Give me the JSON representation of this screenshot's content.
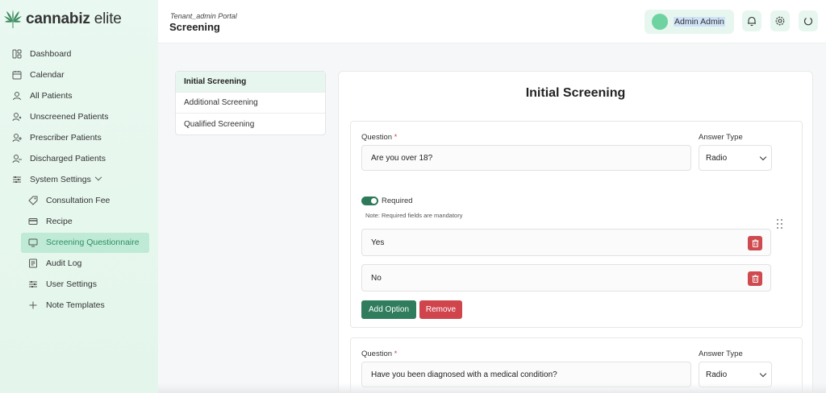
{
  "brand": {
    "name_bold": "cannabiz",
    "name_light": " elite"
  },
  "sidebar": {
    "items": [
      {
        "label": "Dashboard",
        "icon": "dashboard-icon"
      },
      {
        "label": "Calendar",
        "icon": "calendar-icon"
      },
      {
        "label": "All Patients",
        "icon": "user-icon"
      },
      {
        "label": "Unscreened Patients",
        "icon": "user-x-icon"
      },
      {
        "label": "Prescriber Patients",
        "icon": "user-plus-icon"
      },
      {
        "label": "Discharged Patients",
        "icon": "user-minus-icon"
      },
      {
        "label": "System Settings",
        "icon": "sliders-icon"
      }
    ],
    "subitems": [
      {
        "label": "Consultation Fee",
        "icon": "tag-icon"
      },
      {
        "label": "Recipe",
        "icon": "card-icon"
      },
      {
        "label": "Screening Questionnaire",
        "icon": "monitor-icon"
      },
      {
        "label": "Audit Log",
        "icon": "log-icon"
      },
      {
        "label": "User Settings",
        "icon": "sliders-icon"
      },
      {
        "label": "Note Templates",
        "icon": "plus-icon"
      }
    ]
  },
  "header": {
    "portal": "Tenant_admin Portal",
    "title": "Screening",
    "user_name": "Admin Admin"
  },
  "tabs": [
    "Initial Screening",
    "Additional Screening",
    "Qualified Screening"
  ],
  "main": {
    "title": "Initial Screening",
    "question_label": "Question",
    "required_mark": "*",
    "answer_type_label": "Answer Type",
    "required_label": "Required",
    "note": "Note: Required fields are mandatory",
    "add_option": "Add Option",
    "remove": "Remove",
    "questions": [
      {
        "text": "Are you over 18?",
        "answer_type": "Radio",
        "options": [
          "Yes",
          "No"
        ],
        "required": true
      },
      {
        "text": "Have you been diagnosed with a medical condition?",
        "answer_type": "Radio"
      }
    ]
  },
  "colors": {
    "accent": "#2f7d5d",
    "danger": "#d0444c",
    "sidebar_bg": "#e9f8f0",
    "active_bg": "#bfead5"
  }
}
